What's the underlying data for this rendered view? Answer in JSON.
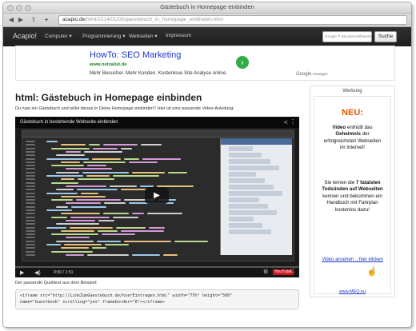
{
  "window": {
    "title": "Gästebuch in Homepage einbinden"
  },
  "toolbar": {
    "url_host": "acapio.de",
    "url_path": "/html/2014/01/03/gaestebuch_in_homepage_einbinden.html",
    "back_icon": "back-icon",
    "forward_icon": "forward-icon",
    "share_icon": "share-icon",
    "add_icon": "add-icon"
  },
  "navbar": {
    "brand": "Acapio!",
    "items": [
      "Computer ▾",
      "Programmierung ▾",
      "Webseiten ▾",
      "Impressum"
    ],
    "search_placeholder": "Google™ Benutzerdefinierte Suche",
    "search_button": "Suche"
  },
  "ad": {
    "headline": "HowTo: SEO Marketing",
    "url": "www.netzalist.de",
    "description": "Mehr Besucher. Mehr Kunden. Kostenlose Site Analyse online.",
    "google": "Google",
    "google_suffix": "-Anzeigen"
  },
  "main": {
    "title": "html: Gästebuch in Homepage einbinden",
    "intro": "Du hast ein Gästebuch und willst dieses in Deine Homepage einbinden? Hier ist eine passende Video-Anleitung:",
    "code_caption": "Der passende Quelltext aus dem Beispiel:",
    "code_line1": "<iframe src=\"http://LinkZumGaestebuch.de/hierEintragen.html\" width=\"75%\" height=\"500\"",
    "code_line2": "name=\"Guestbook\" scrolling=\"yes\" frameborder=\"0\"></iframe>"
  },
  "video": {
    "title": "Gästebuch in bestehende Webseite einbinden",
    "time": "0:00 / 1:51",
    "youtube": "YouTube",
    "progress": 0.0
  },
  "sidebar": {
    "label": "Werbung",
    "new": "NEU:",
    "p1_pre": "Video",
    "p1_mid1": "enthüllt das",
    "p1_bold": "Geheimnis",
    "p1_post": "der erfolgreichsten Webseiten im Internet!",
    "p2_pre": "Sie lernen die",
    "p2_bold1": "7 fatalsten Todsünden auf Webseiten",
    "p2_post": "kennen und bekommen ein Handbuch mit Fahrplan kostenlos dazu!",
    "link": "Video ansehen ...hier klicken",
    "footer_link": "www.MEQ.eu"
  },
  "colors": {
    "accent_link": "#1a35c7",
    "new_orange": "#e05a00",
    "ad_green": "#2fae48"
  }
}
